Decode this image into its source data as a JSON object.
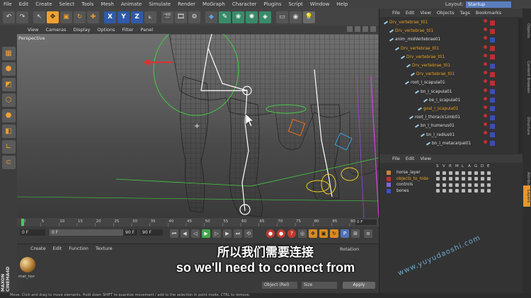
{
  "menubar": {
    "items": [
      "File",
      "Edit",
      "Create",
      "Select",
      "Tools",
      "Mesh",
      "Animate",
      "Simulate",
      "Render",
      "MoGraph",
      "Character",
      "Plugins",
      "Script",
      "Window",
      "Help"
    ],
    "layout_label": "Layout:",
    "layout_value": "Startup"
  },
  "viewport": {
    "menu": [
      "View",
      "Cameras",
      "Display",
      "Options",
      "Filter",
      "Panel"
    ],
    "label": "Perspective"
  },
  "timeline": {
    "ticks": [
      "0",
      "5",
      "10",
      "15",
      "20",
      "25",
      "30",
      "35",
      "40",
      "45",
      "50",
      "55",
      "60",
      "65",
      "70",
      "75",
      "80",
      "85",
      "90"
    ],
    "current_frame": "0 F"
  },
  "transport": {
    "start": "0 F",
    "start2": "0 F",
    "end": "90 F",
    "end2": "90 F"
  },
  "materials": {
    "menu": [
      "Create",
      "Edit",
      "Function",
      "Texture"
    ],
    "material_name": "mat_hor"
  },
  "attributes": {
    "title": "Rotation",
    "coord_mode": "Object (Rel)",
    "size_mode": "Size",
    "apply": "Apply"
  },
  "object_manager": {
    "menu": [
      "File",
      "Edit",
      "View",
      "Objects",
      "Tags",
      "Bookmarks"
    ],
    "rows": [
      {
        "name": "Drv_vertebrae_t01",
        "indent": 14,
        "color": "orange"
      },
      {
        "name": "Drv_vertebrae_t01",
        "indent": 22,
        "color": "orange"
      },
      {
        "name": "anim_midVertebrae01",
        "indent": 22,
        "color": "white"
      },
      {
        "name": "Drv_vertebrae_t01",
        "indent": 30,
        "color": "orange"
      },
      {
        "name": "Drv_vertebrae_t01",
        "indent": 38,
        "color": "orange"
      },
      {
        "name": "Drv_vertebrae_t01",
        "indent": 46,
        "color": "orange"
      },
      {
        "name": "Drv_vertebrae_t01",
        "indent": 52,
        "color": "orange"
      },
      {
        "name": "root_l_scapula01",
        "indent": 44,
        "color": "white"
      },
      {
        "name": "bn_l_scapula01",
        "indent": 58,
        "color": "white"
      },
      {
        "name": "be_l_scapula01",
        "indent": 70,
        "color": "white"
      },
      {
        "name": "goal_l_scapula01",
        "indent": 62,
        "color": "orange"
      },
      {
        "name": "root_l_thoracicLimb01",
        "indent": 50,
        "color": "white"
      },
      {
        "name": "bn_l_humerus01",
        "indent": 58,
        "color": "white"
      },
      {
        "name": "bn_l_radius01",
        "indent": 66,
        "color": "white"
      },
      {
        "name": "bn_l_metacarpal01",
        "indent": 74,
        "color": "white"
      }
    ]
  },
  "layer_manager": {
    "menu": [
      "File",
      "Edit",
      "View"
    ],
    "columns": [
      "S",
      "V",
      "R",
      "M",
      "L",
      "A",
      "G",
      "D",
      "E"
    ],
    "layers": [
      {
        "name": "horse_layer",
        "color": "#c8883a"
      },
      {
        "name": "objects_to_hide",
        "color": "#c23030"
      },
      {
        "name": "controls",
        "color": "#7a6ad8"
      },
      {
        "name": "bones",
        "color": "#3a50c8"
      }
    ]
  },
  "side_tabs": [
    "Objects",
    "Content Browser",
    "Structure",
    "Attributes",
    "Layers"
  ],
  "status": "Move: Click and drag to move elements. Hold down SHIFT to quantize movement / add to the selection in point mode, CTRL to remove.",
  "subtitles": {
    "chinese": "所以我们需要连接",
    "english": "so we'll need to connect from"
  },
  "watermark": "www.yuyudaoshi.com",
  "logo": "MAXON CINEMA 4D"
}
